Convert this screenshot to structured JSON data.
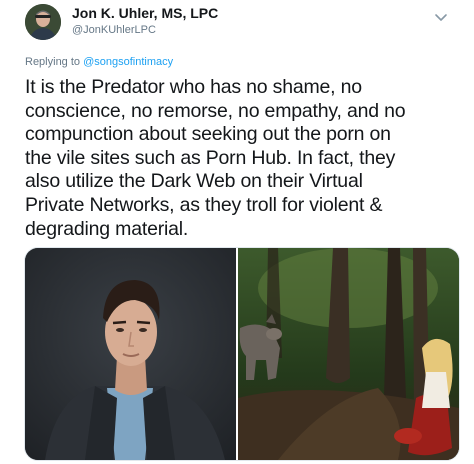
{
  "tweet": {
    "author_name": "Jon K. Uhler, MS, LPC",
    "author_handle": "@JonKUhlerLPC",
    "reply_prefix": "Replying to",
    "reply_to": "@songsofintimacy",
    "text": "It is the Predator who has no shame, no\nconscience, no remorse, no empathy, and no\ncompunction about seeking out the porn on\nthe vile sites such as Porn Hub. In fact, they\nalso utilize the Dark Web on their Virtual\nPrivate Networks, as they troll for violent &\ndegrading material."
  },
  "icons": {
    "menu": "chevron-down-icon",
    "avatar": "avatar"
  },
  "colors": {
    "text": "#14171a",
    "secondary": "#657786",
    "link": "#1da1f2"
  }
}
